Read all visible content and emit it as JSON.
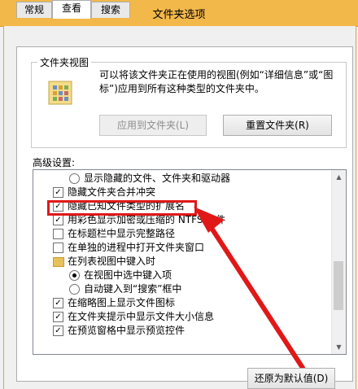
{
  "window": {
    "title": "文件夹选项"
  },
  "tabs": [
    {
      "label": "常规"
    },
    {
      "label": "查看"
    },
    {
      "label": "搜索"
    }
  ],
  "folder_view": {
    "group_label": "文件夹视图",
    "description": "可以将该文件夹正在使用的视图(例如“详细信息”或“图标”)应用到所有这种类型的文件夹中。",
    "apply_button": "应用到文件夹(L)",
    "reset_button": "重置文件夹(R)"
  },
  "advanced": {
    "label": "高级设置:",
    "items": [
      {
        "type": "radio",
        "checked": false,
        "label": "显示隐藏的文件、文件夹和驱动器",
        "indent": 1
      },
      {
        "type": "checkbox",
        "checked": true,
        "label": "隐藏文件夹合并冲突",
        "indent": 0
      },
      {
        "type": "checkbox",
        "checked": true,
        "label": "隐藏已知文件类型的扩展名",
        "indent": 0
      },
      {
        "type": "checkbox",
        "checked": true,
        "label": "用彩色显示加密或压缩的 NTFS 文件",
        "indent": 0
      },
      {
        "type": "checkbox",
        "checked": false,
        "label": "在标题栏中显示完整路径",
        "indent": 0
      },
      {
        "type": "checkbox",
        "checked": false,
        "label": "在单独的进程中打开文件夹窗口",
        "indent": 0
      },
      {
        "type": "folder",
        "checked": false,
        "label": "在列表视图中键入时",
        "indent": 0
      },
      {
        "type": "radio",
        "checked": true,
        "label": "在视图中选中键入项",
        "indent": 1
      },
      {
        "type": "radio",
        "checked": false,
        "label": "自动键入到“搜索”框中",
        "indent": 1
      },
      {
        "type": "checkbox",
        "checked": true,
        "label": "在缩略图上显示文件图标",
        "indent": 0
      },
      {
        "type": "checkbox",
        "checked": true,
        "label": "在文件夹提示中显示文件大小信息",
        "indent": 0
      },
      {
        "type": "checkbox",
        "checked": true,
        "label": "在预览窗格中显示预览控件",
        "indent": 0
      }
    ],
    "restore_button": "还原为默认值(D)"
  },
  "colors": {
    "titlebar": "#f2b84a",
    "annotation": "#e01818"
  }
}
